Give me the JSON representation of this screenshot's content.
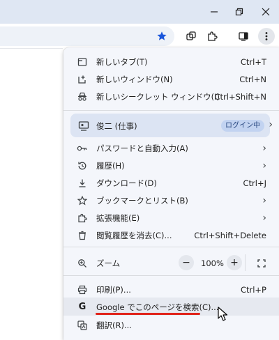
{
  "window": {
    "minimize_icon": "minimize-icon",
    "restore_icon": "restore-icon",
    "close_icon": "close-icon"
  },
  "toolbar": {
    "icons": [
      "bookmark-star-icon",
      "tab-search-icon",
      "extensions-icon",
      "side-panel-icon",
      "more-menu-icon"
    ]
  },
  "menu": {
    "new_tab": {
      "label": "新しいタブ(T)",
      "shortcut": "Ctrl+T"
    },
    "new_window": {
      "label": "新しいウィンドウ(N)",
      "shortcut": "Ctrl+N"
    },
    "incognito": {
      "label": "新しいシークレット ウィンドウ(I)",
      "shortcut": "Ctrl+Shift+N"
    },
    "profile": {
      "label": "俊二 (仕事)",
      "badge": "ログイン中"
    },
    "passwords": {
      "label": "パスワードと自動入力(A)"
    },
    "history": {
      "label": "履歴(H)"
    },
    "downloads": {
      "label": "ダウンロード(D)",
      "shortcut": "Ctrl+J"
    },
    "bookmarks": {
      "label": "ブックマークとリスト(B)"
    },
    "extensions": {
      "label": "拡張機能(E)"
    },
    "clear_history": {
      "label": "閲覧履歴を消去(C)...",
      "shortcut": "Ctrl+Shift+Delete"
    },
    "zoom": {
      "label": "ズーム",
      "minus": "−",
      "value": "100%",
      "plus": "+"
    },
    "print": {
      "label": "印刷(P)...",
      "shortcut": "Ctrl+P"
    },
    "search_page": {
      "label": "Google でこのページを検索(C)..."
    },
    "translate": {
      "label": "翻訳(R)..."
    }
  },
  "colors": {
    "accent_star": "#1a56db",
    "highlight_underline": "#e0231a"
  }
}
